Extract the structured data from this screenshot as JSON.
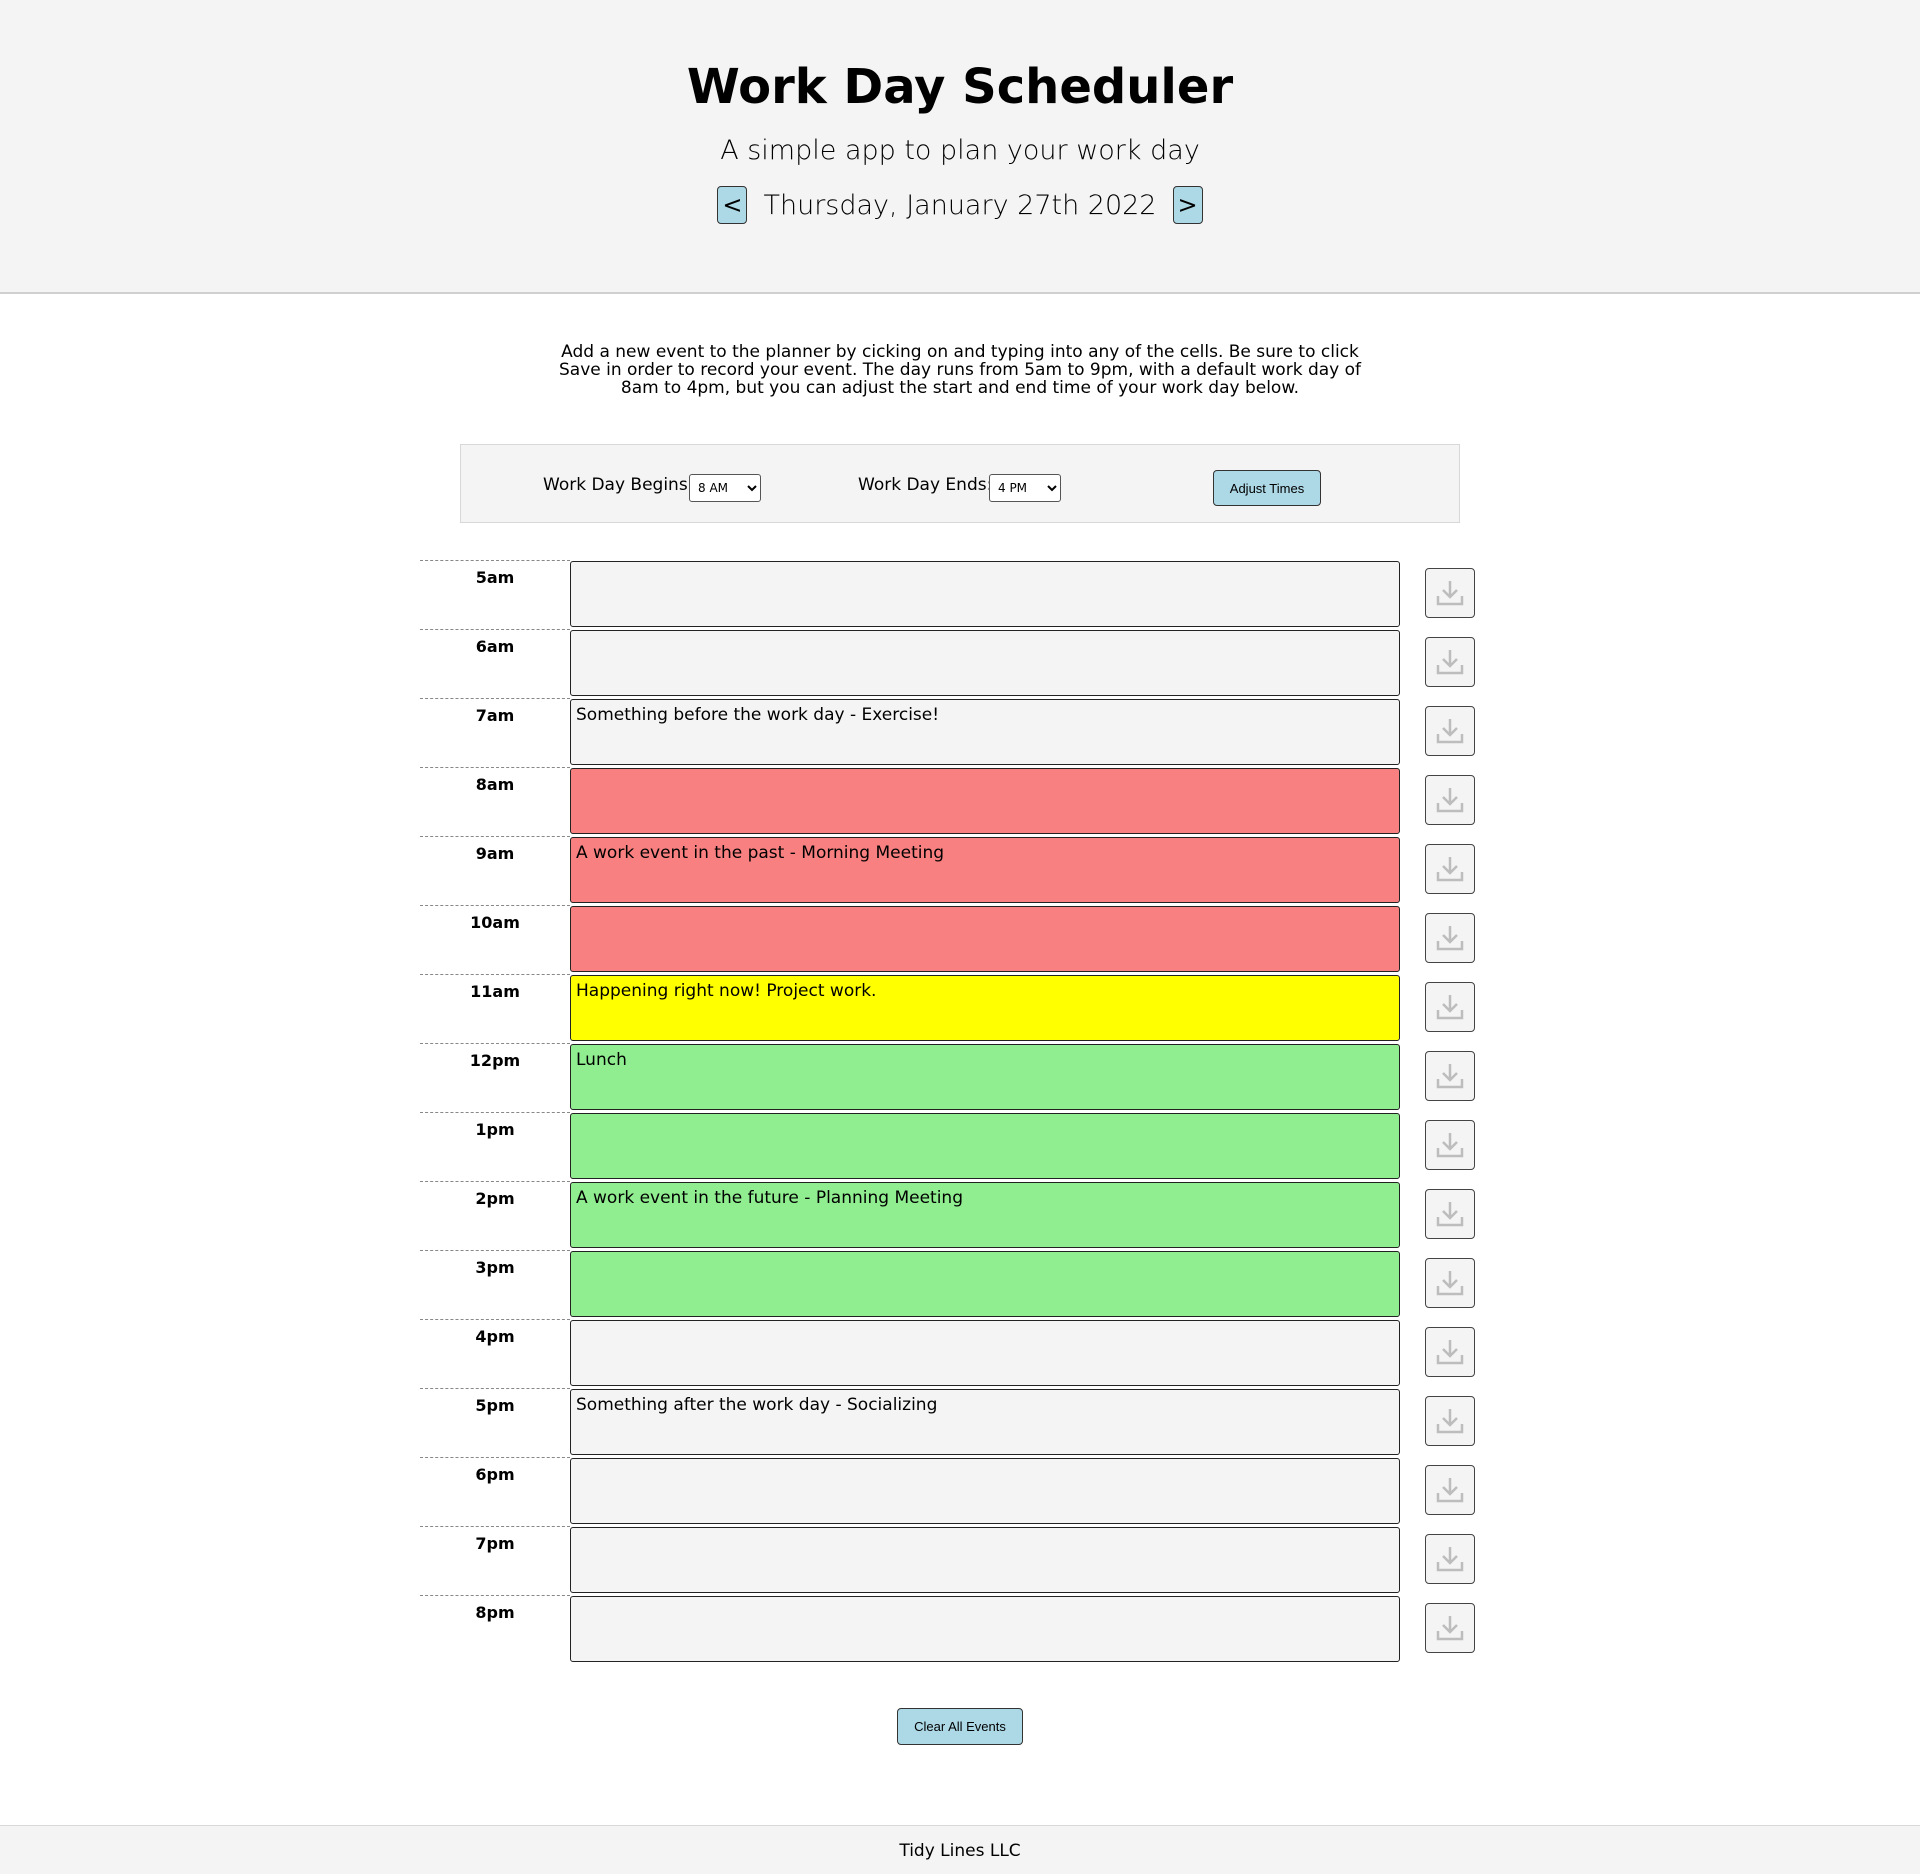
{
  "header": {
    "title": "Work Day Scheduler",
    "subtitle": "A simple app to plan your work day",
    "prev_label": "<",
    "next_label": ">",
    "date": "Thursday, January 27th 2022"
  },
  "instructions": "Add a new event to the planner by cicking on and typing into any of the cells. Be sure to click Save in order to record your event. The day runs from 5am to 9pm, with a default work day of 8am to 4pm, but you can adjust the start and end time of your work day below.",
  "controls": {
    "begin_label": "Work Day Begins:",
    "begin_value": "8 AM",
    "end_label": "Work Day Ends:",
    "end_value": "4 PM",
    "adjust_label": "Adjust Times"
  },
  "colors": {
    "past": "#f88080",
    "present": "#ffff00",
    "future": "#90ee90",
    "off_hours": "#f4f4f4",
    "button": "#add8e6"
  },
  "hours": [
    {
      "label": "5am",
      "event": "",
      "state": "off"
    },
    {
      "label": "6am",
      "event": "",
      "state": "off"
    },
    {
      "label": "7am",
      "event": "Something before the work day - Exercise!",
      "state": "off"
    },
    {
      "label": "8am",
      "event": "",
      "state": "past"
    },
    {
      "label": "9am",
      "event": "A work event in the past - Morning Meeting",
      "state": "past"
    },
    {
      "label": "10am",
      "event": "",
      "state": "past"
    },
    {
      "label": "11am",
      "event": "Happening right now! Project work.",
      "state": "present"
    },
    {
      "label": "12pm",
      "event": "Lunch",
      "state": "future"
    },
    {
      "label": "1pm",
      "event": "",
      "state": "future"
    },
    {
      "label": "2pm",
      "event": "A work event in the future - Planning Meeting",
      "state": "future"
    },
    {
      "label": "3pm",
      "event": "",
      "state": "future"
    },
    {
      "label": "4pm",
      "event": "",
      "state": "off"
    },
    {
      "label": "5pm",
      "event": "Something after the work day - Socializing",
      "state": "off"
    },
    {
      "label": "6pm",
      "event": "",
      "state": "off"
    },
    {
      "label": "7pm",
      "event": "",
      "state": "off"
    },
    {
      "label": "8pm",
      "event": "",
      "state": "off"
    }
  ],
  "save_icon": "download-icon",
  "clear_label": "Clear All Events",
  "footer": "Tidy Lines LLC"
}
